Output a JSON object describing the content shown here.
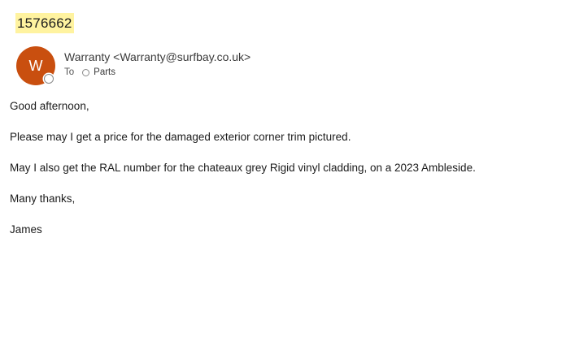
{
  "email": {
    "subject": "1576662",
    "sender": {
      "avatar_initial": "W",
      "avatar_color": "#c94f0f",
      "display": "Warranty <Warranty@surfbay.co.uk>"
    },
    "recipients": {
      "to_label": "To",
      "to_name": "Parts"
    },
    "body_lines": [
      "Good afternoon,",
      "Please may I get a price for the damaged exterior corner trim pictured.",
      "May I also get the RAL number for the chateaux grey Rigid vinyl cladding, on a 2023 Ambleside.",
      "Many thanks,",
      "James"
    ]
  },
  "colors": {
    "subject_highlight": "#fff3a0",
    "text": "#1b1b1b"
  }
}
